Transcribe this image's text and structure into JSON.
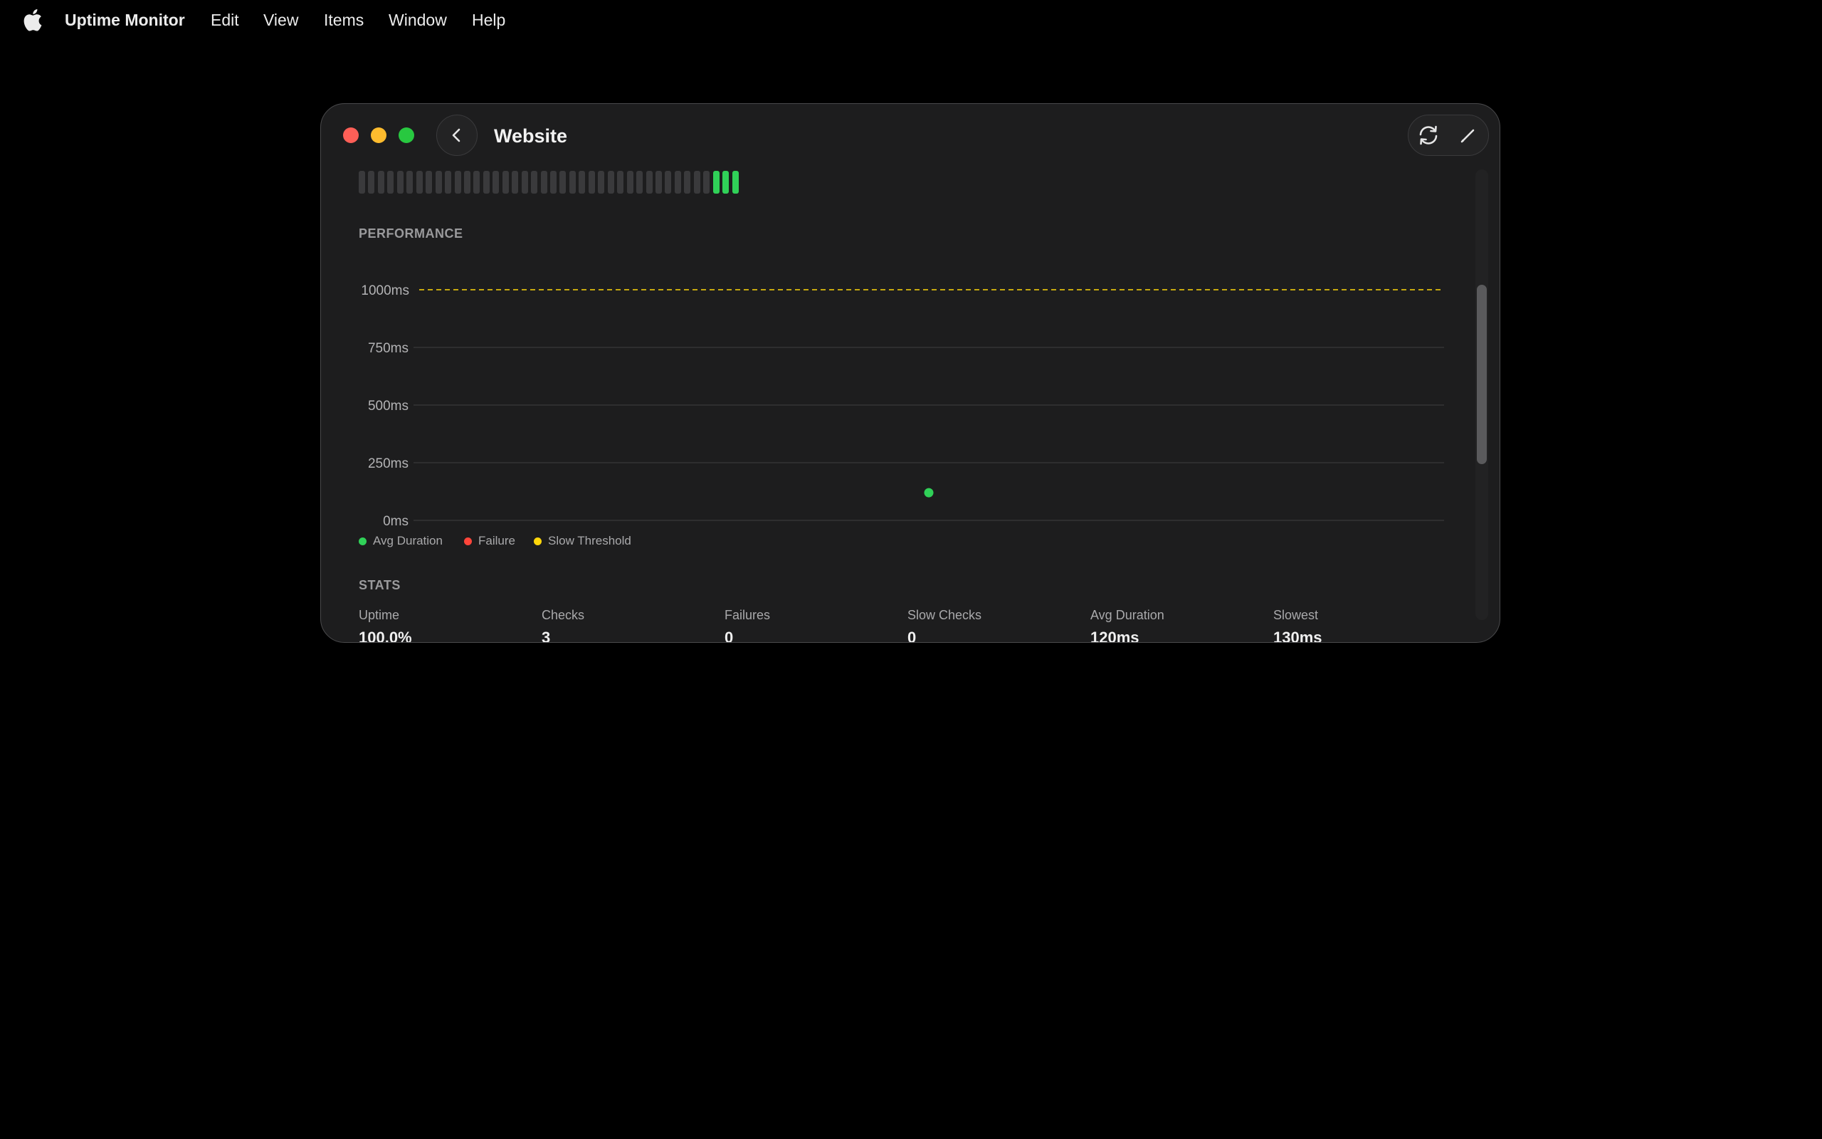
{
  "menubar": {
    "app_name": "Uptime Monitor",
    "items": [
      "Edit",
      "View",
      "Items",
      "Window",
      "Help"
    ]
  },
  "window": {
    "title": "Website",
    "toolbar": {
      "back_icon": "chevron-left-icon",
      "refresh_icon": "refresh-icon",
      "edit_icon": "pencil-icon"
    },
    "colors": {
      "close": "#fe5f57",
      "minimize": "#febc2e",
      "zoom": "#28c840",
      "success": "#30d158",
      "failure": "#ff453a",
      "slow": "#ffd60a",
      "empty_bar": "#3a3a3c"
    }
  },
  "history": {
    "statuses": [
      "empty",
      "empty",
      "empty",
      "empty",
      "empty",
      "empty",
      "empty",
      "empty",
      "empty",
      "empty",
      "empty",
      "empty",
      "empty",
      "empty",
      "empty",
      "empty",
      "empty",
      "empty",
      "empty",
      "empty",
      "empty",
      "empty",
      "empty",
      "empty",
      "empty",
      "empty",
      "empty",
      "empty",
      "empty",
      "empty",
      "empty",
      "empty",
      "empty",
      "empty",
      "empty",
      "empty",
      "empty",
      "success",
      "success",
      "success"
    ]
  },
  "performance": {
    "label": "PERFORMANCE",
    "legend": [
      "Avg Duration",
      "Failure",
      "Slow Threshold"
    ]
  },
  "chart_data": {
    "type": "scatter",
    "title": "",
    "xlabel": "",
    "ylabel": "",
    "ylim": [
      0,
      1000
    ],
    "y_ticks": [
      "0ms",
      "250ms",
      "500ms",
      "750ms",
      "1000ms"
    ],
    "y_tick_values": [
      0,
      250,
      500,
      750,
      1000
    ],
    "grid": true,
    "slow_threshold": 1000,
    "series": [
      {
        "name": "Avg Duration",
        "color": "#30d158",
        "points": [
          {
            "x": 0.5,
            "y": 120
          }
        ]
      }
    ],
    "x_range": [
      0,
      1
    ]
  },
  "stats": {
    "label": "STATS",
    "items": [
      {
        "label": "Uptime",
        "value": "100.0%"
      },
      {
        "label": "Checks",
        "value": "3"
      },
      {
        "label": "Failures",
        "value": "0"
      },
      {
        "label": "Slow Checks",
        "value": "0"
      },
      {
        "label": "Avg Duration",
        "value": "120ms"
      },
      {
        "label": "Slowest",
        "value": "130ms"
      }
    ]
  }
}
